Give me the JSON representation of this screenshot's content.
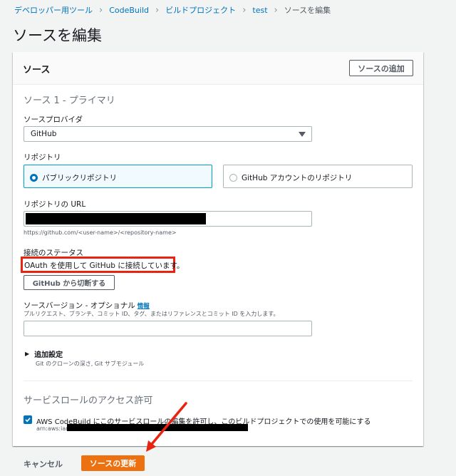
{
  "breadcrumb": {
    "items": [
      "デベロッパー用ツール",
      "CodeBuild",
      "ビルドプロジェクト",
      "test"
    ],
    "current": "ソースを編集"
  },
  "page_title": "ソースを編集",
  "panel": {
    "title": "ソース",
    "add_source_label": "ソースの追加",
    "source_heading": "ソース 1 - プライマリ",
    "provider": {
      "label": "ソースプロバイダ",
      "value": "GitHub"
    },
    "repository": {
      "label": "リポジトリ",
      "options": [
        {
          "label": "パブリックリポジトリ",
          "selected": true
        },
        {
          "label": "GitHub アカウントのリポジトリ",
          "selected": false
        }
      ]
    },
    "repo_url": {
      "label": "リポジトリの URL",
      "hint": "https://github.com/<user-name>/<repository-name>"
    },
    "connection": {
      "label": "接続のステータス",
      "status": "OAuth を使用して GitHub に接続しています。",
      "disconnect_label": "GitHub から切断する"
    },
    "source_version": {
      "label": "ソースバージョン - オプショナル",
      "info": "情報",
      "description": "プルリクエスト、ブランチ、コミット ID、タグ、またはリファレンスとコミット ID を入力します。"
    },
    "advanced": {
      "label": "追加設定",
      "description": "Git のクローンの深さ, Git サブモジュール"
    },
    "service_role": {
      "heading": "サービスロールのアクセス許可",
      "checkbox_label": "AWS CodeBuild にこのサービスロールの編集を許可し、このビルドプロジェクトでの使用を可能にする",
      "arn_prefix": "arn:aws:iam"
    }
  },
  "footer": {
    "cancel_label": "キャンセル",
    "submit_label": "ソースの更新"
  },
  "colors": {
    "annotation": "#e8230f",
    "primary": "#ec7211",
    "link": "#0073bb"
  }
}
